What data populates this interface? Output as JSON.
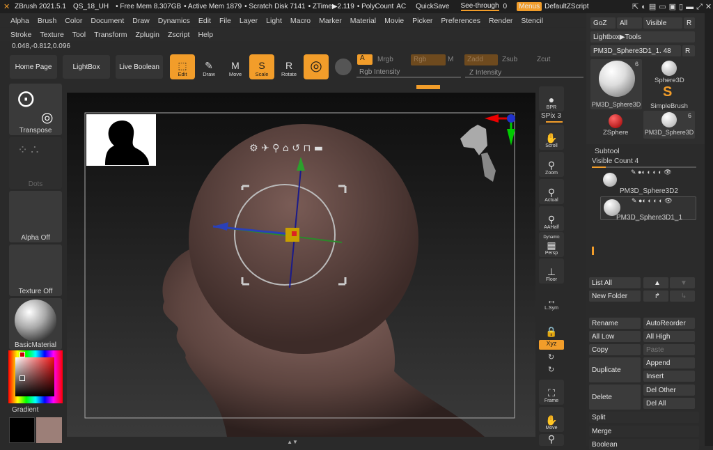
{
  "titlebar": {
    "app": "ZBrush 2021.5.1",
    "file": "QS_18_UH",
    "free_mem": "• Free Mem 8.307GB",
    "active_mem": "• Active Mem 1879",
    "scratch": "• Scratch Disk 7141",
    "ztime": "• ZTime▶2.119",
    "polycount": "• PolyCount",
    "ac": "AC",
    "quicksave": "QuickSave",
    "seethrough": "See-through",
    "seethrough_val": "0",
    "menus": "Menus",
    "script": "DefaultZScript"
  },
  "menu1": [
    "Alpha",
    "Brush",
    "Color",
    "Document",
    "Draw",
    "Dynamics",
    "Edit",
    "File",
    "Layer",
    "Light",
    "Macro",
    "Marker",
    "Material",
    "Movie",
    "Picker",
    "Preferences",
    "Render",
    "Stencil"
  ],
  "menu2": [
    "Stroke",
    "Texture",
    "Tool",
    "Transform",
    "Zplugin",
    "Zscript",
    "Help"
  ],
  "coords": "0.048,-0.812,0.096",
  "shelf": {
    "home": "Home Page",
    "lightbox": "LightBox",
    "liveboolean": "Live Boolean",
    "edit": "Edit",
    "draw": "Draw",
    "move": "Move",
    "scale": "Scale",
    "rotate": "Rotate",
    "a": "A",
    "mrgb": "Mrgb",
    "rgb": "Rgb",
    "m": "M",
    "zadd": "Zadd",
    "zsub": "Zsub",
    "zcut": "Zcut",
    "rgb_intensity": "Rgb Intensity",
    "z_intensity": "Z Intensity"
  },
  "left": {
    "transpose": "Transpose",
    "dots": "Dots",
    "alpha": "Alpha Off",
    "texture": "Texture Off",
    "material": "BasicMaterial",
    "gradient": "Gradient"
  },
  "righttools": {
    "bpr": "BPR",
    "spix": "SPix 3",
    "scroll": "Scroll",
    "zoom": "Zoom",
    "actual": "Actual",
    "aahalf": "AAHalf",
    "dynamic": "Dynamic",
    "persp": "Persp",
    "floor": "Floor",
    "lsym": "L.Sym",
    "xyz": "Xyz",
    "frame": "Frame",
    "move": "Move"
  },
  "toolpanel": {
    "goz": "GoZ",
    "all": "All",
    "visible": "Visible",
    "r": "R",
    "lightbox_tools": "Lightbox▶Tools",
    "current_tool": "PM3D_Sphere3D1_1. 48",
    "r2": "R",
    "thumb_big": "PM3D_Sphere3D",
    "thumb_big_count": "6",
    "sphere3d": "Sphere3D",
    "simplebrush": "SimpleBrush",
    "zsphere": "ZSphere",
    "pm3d2": "PM3D_Sphere3D",
    "pm3d2_count": "6"
  },
  "subtool": {
    "title": "Subtool",
    "visible_count": "Visible Count 4",
    "items": [
      "PM3D_Sphere3D2",
      "PM3D_Sphere3D1_1"
    ],
    "list_all": "List All",
    "new_folder": "New Folder",
    "rename": "Rename",
    "autoreorder": "AutoReorder",
    "all_low": "All Low",
    "all_high": "All High",
    "copy": "Copy",
    "paste": "Paste",
    "duplicate": "Duplicate",
    "append": "Append",
    "insert": "Insert",
    "delete": "Delete",
    "del_other": "Del Other",
    "del_all": "Del All",
    "split": "Split",
    "merge": "Merge",
    "boolean": "Boolean"
  },
  "colors": {
    "accent": "#f29d2a",
    "bg": "#2a2a2a",
    "canvas": "#1c1c1c"
  }
}
